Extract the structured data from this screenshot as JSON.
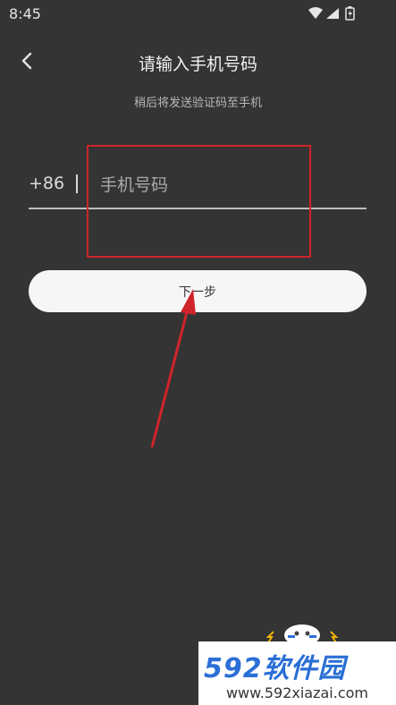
{
  "status_bar": {
    "time": "8:45",
    "icons": [
      "wifi-icon",
      "signal-icon",
      "battery-icon"
    ]
  },
  "header": {
    "back_icon": "chevron-left-icon",
    "title": "请输入手机号码"
  },
  "subtitle": "稍后将发送验证码至手机",
  "phone": {
    "country_code": "+86",
    "value": "",
    "placeholder": "手机号码"
  },
  "next_button": {
    "label": "下一步"
  },
  "watermark": {
    "brand": "592软件园",
    "url": "www.592xiazai.com"
  },
  "colors": {
    "background": "#343434",
    "button_bg": "#f6f6f6",
    "annotation": "#d0242a",
    "brand": "#2a6fd6"
  }
}
